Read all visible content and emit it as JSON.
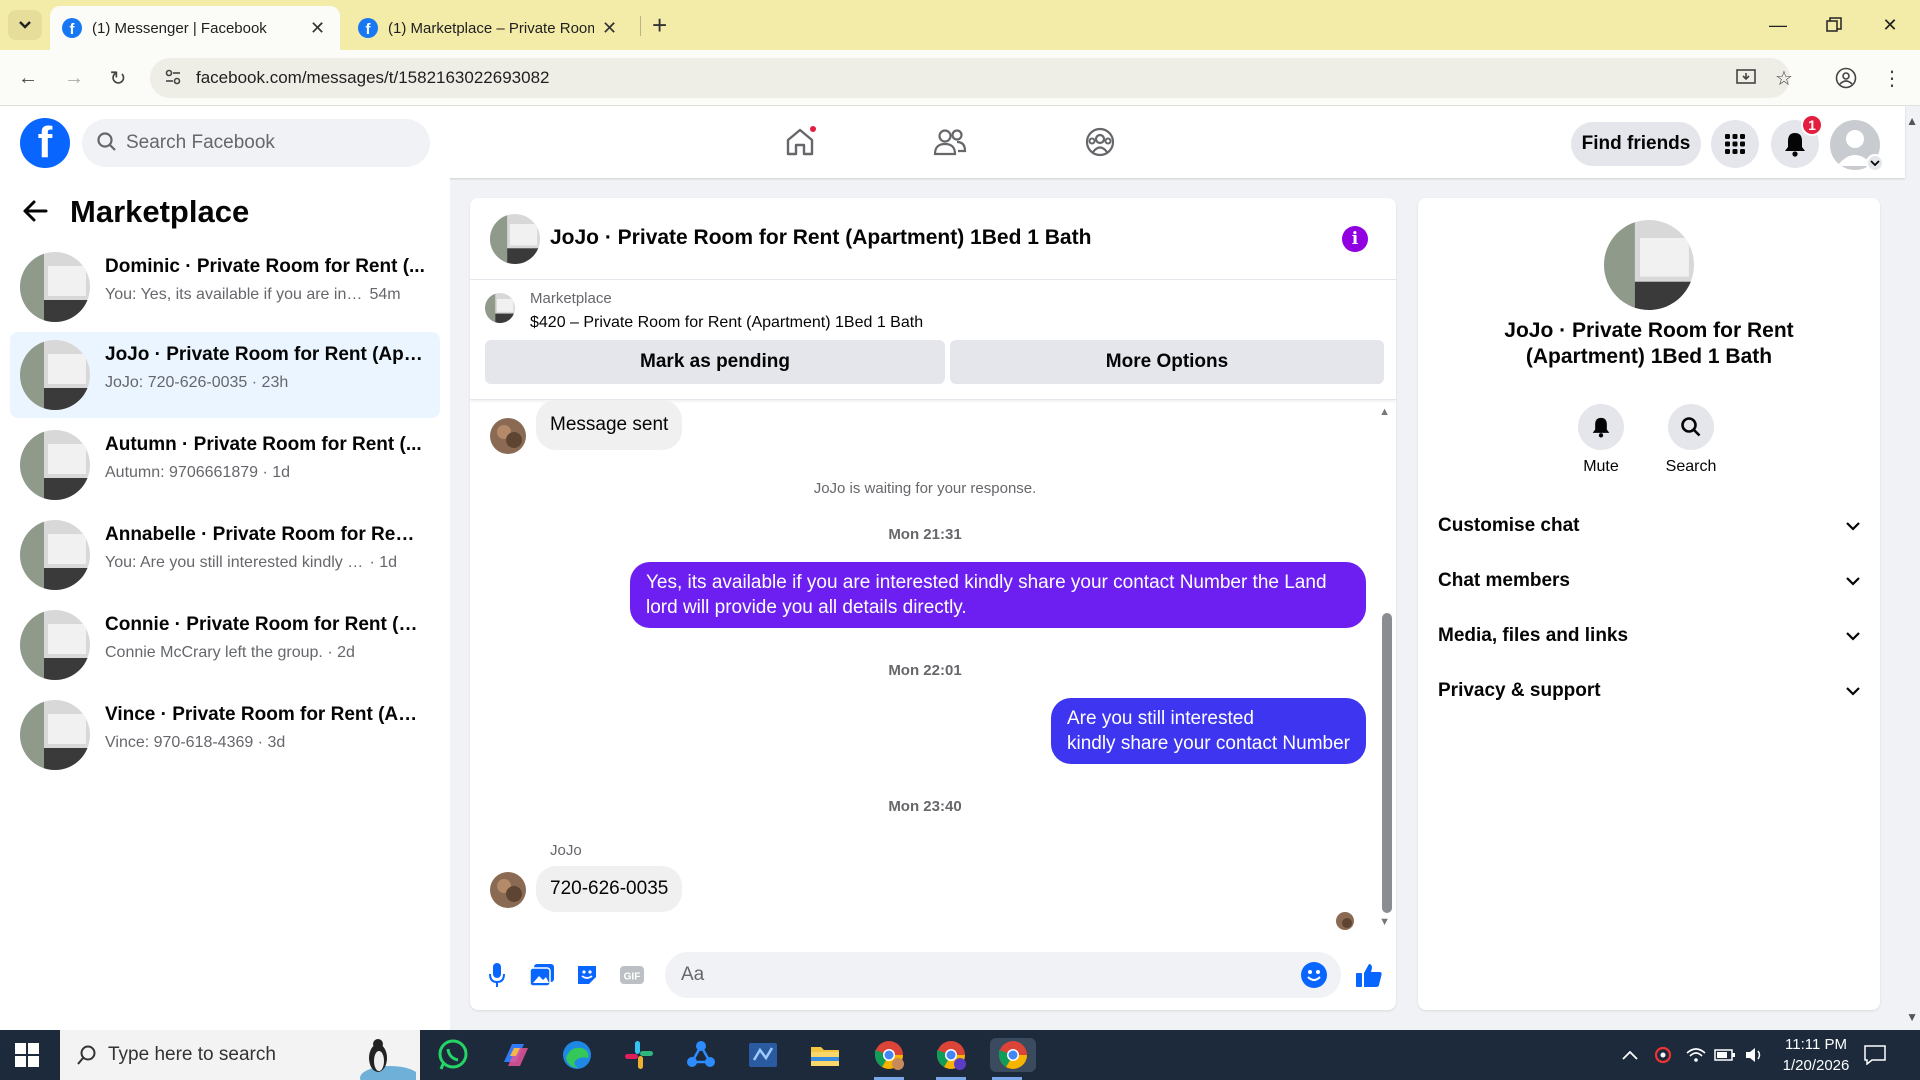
{
  "browser": {
    "tabs": [
      {
        "title": "(1) Messenger | Facebook",
        "active": true
      },
      {
        "title": "(1) Marketplace – Private Room",
        "active": false
      }
    ],
    "url": "facebook.com/messages/t/1582163022693082"
  },
  "header": {
    "search_placeholder": "Search Facebook",
    "find_friends": "Find friends",
    "notification_count": "1"
  },
  "sidebar": {
    "title": "Marketplace",
    "conversations": [
      {
        "name": "Dominic · Private Room for Rent (...",
        "snippet": "You: Yes, its available if you are inter...",
        "time": "54m"
      },
      {
        "name": "JoJo · Private Room for Rent (Apar...",
        "snippet": "JoJo: 720-626-0035",
        "time": "23h"
      },
      {
        "name": "Autumn · Private Room for Rent (...",
        "snippet": "Autumn: 9706661879",
        "time": "1d"
      },
      {
        "name": "Annabelle · Private Room for Rent ...",
        "snippet": "You: Are you still interested kindly sha...",
        "time": "1d"
      },
      {
        "name": "Connie · Private Room for Rent (A...",
        "snippet": "Connie McCrary left the group.",
        "time": "2d"
      },
      {
        "name": "Vince · Private Room for Rent (Apa...",
        "snippet": "Vince: 970-618-4369",
        "time": "3d"
      }
    ]
  },
  "chat": {
    "title": "JoJo · Private Room for Rent (Apartment) 1Bed 1 Bath",
    "marketplace_label": "Marketplace",
    "listing": "$420 – Private Room for Rent (Apartment) 1Bed 1 Bath",
    "mark_pending": "Mark as pending",
    "more_options": "More Options",
    "messages": {
      "sent_notice": "Message sent",
      "waiting": "JoJo is waiting for your response.",
      "time1": "Mon 21:31",
      "out1": "Yes, its available if you are interested kindly share your contact Number the Land lord will provide you all details directly.",
      "time2": "Mon 22:01",
      "out2_line1": "Are you still interested",
      "out2_line2": "kindly share your contact Number",
      "time3": "Mon 23:40",
      "sender": "JoJo",
      "in1": "720-626-0035"
    },
    "composer_placeholder": "Aa"
  },
  "right_panel": {
    "name": "JoJo · Private Room for Rent (Apartment) 1Bed 1 Bath",
    "mute": "Mute",
    "search": "Search",
    "sections": [
      "Customise chat",
      "Chat members",
      "Media, files and links",
      "Privacy & support"
    ]
  },
  "taskbar": {
    "search_placeholder": "Type here to search",
    "time": "11:11 PM",
    "date": "1/20/2026"
  },
  "colors": {
    "fb_blue": "#0866ff",
    "outgoing_bubble": "#6c1ff0",
    "info_purple": "#9000e0"
  }
}
